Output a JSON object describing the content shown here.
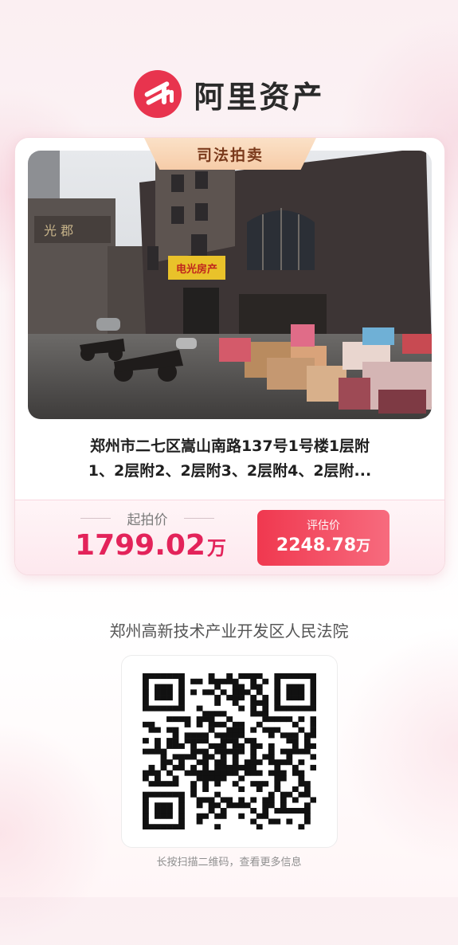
{
  "brand": {
    "name": "阿里资产",
    "logo_icon": "ali-asset-logo-icon",
    "accent": "#e8344e"
  },
  "listing": {
    "tag": "司法拍卖",
    "title_line1": "郑州市二七区嵩山南路137号1号楼1层附",
    "title_line2": "1、2层附2、2层附3、2层附4、2层附...",
    "start_price_label": "起拍价",
    "start_price": "1799.02",
    "start_price_unit": "万",
    "eval_price_label": "评估价",
    "eval_price": "2248.78",
    "eval_price_unit": "万",
    "photo_sign": "电光房产"
  },
  "court": "郑州高新技术产业开发区人民法院",
  "qr_hint": "长按扫描二维码，查看更多信息",
  "colors": {
    "price_red": "#e3235a",
    "tag_bg": "#f6cca8"
  }
}
